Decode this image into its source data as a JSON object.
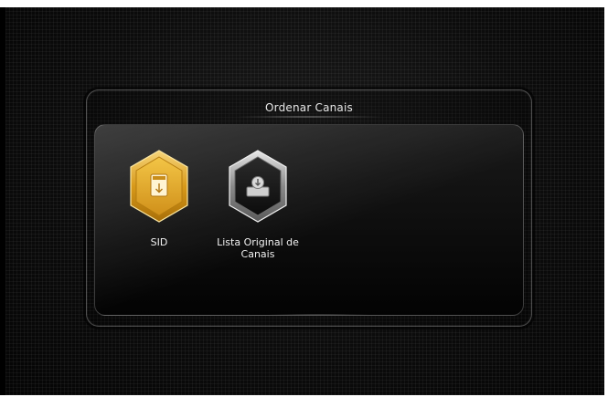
{
  "menu": {
    "title": "Ordenar Canais",
    "items": [
      {
        "label_line1": "SID",
        "label_line2": "",
        "selected": true,
        "icon": "sid-card-icon"
      },
      {
        "label_line1": "Lista Original de",
        "label_line2": "Canais",
        "selected": false,
        "icon": "original-list-icon"
      }
    ]
  },
  "colors": {
    "selected": "#e0a826",
    "unselected": "#9a9a9a",
    "background": "#0a0a0a"
  }
}
